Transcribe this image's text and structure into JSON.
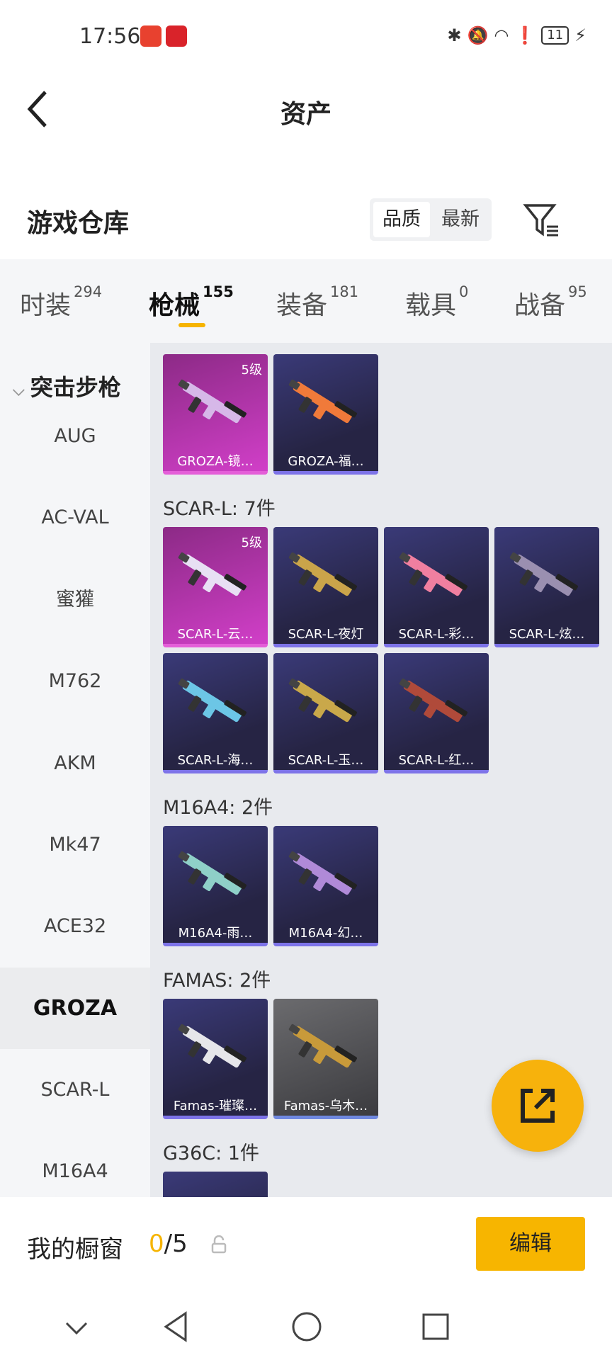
{
  "status_bar": {
    "time": "17:56",
    "battery": "11"
  },
  "header": {
    "title": "资产"
  },
  "warehouse": {
    "title": "游戏仓库",
    "sort": [
      "品质",
      "最新"
    ]
  },
  "tabs": [
    {
      "label": "时装",
      "count": "294"
    },
    {
      "label": "枪械",
      "count": "155"
    },
    {
      "label": "装备",
      "count": "181"
    },
    {
      "label": "载具",
      "count": "0"
    },
    {
      "label": "战备",
      "count": "95"
    }
  ],
  "sidebar": {
    "category": "突击步枪",
    "items": [
      "AUG",
      "AC-VAL",
      "蜜獾",
      "M762",
      "AKM",
      "Mk47",
      "ACE32",
      "GROZA",
      "SCAR-L",
      "M16A4"
    ],
    "selected": "GROZA"
  },
  "groups": [
    {
      "header": "",
      "items": [
        {
          "name": "GROZA-镜…",
          "level": "5级",
          "style": "pink"
        },
        {
          "name": "GROZA-福…",
          "style": "blue"
        }
      ]
    },
    {
      "header": "SCAR-L: 7件",
      "items": [
        {
          "name": "SCAR-L-云…",
          "level": "5级",
          "style": "pink"
        },
        {
          "name": "SCAR-L-夜灯",
          "style": "blue"
        },
        {
          "name": "SCAR-L-彩…",
          "style": "blue"
        },
        {
          "name": "SCAR-L-炫…",
          "style": "blue"
        },
        {
          "name": "SCAR-L-海…",
          "style": "blue"
        },
        {
          "name": "SCAR-L-玉…",
          "style": "blue"
        },
        {
          "name": "SCAR-L-红…",
          "style": "blue"
        }
      ]
    },
    {
      "header": "M16A4: 2件",
      "items": [
        {
          "name": "M16A4-雨…",
          "style": "blue"
        },
        {
          "name": "M16A4-幻…",
          "style": "blue"
        }
      ]
    },
    {
      "header": "FAMAS: 2件",
      "items": [
        {
          "name": "Famas-璀璨…",
          "style": "blue"
        },
        {
          "name": "Famas-乌木…",
          "style": "gray"
        }
      ]
    },
    {
      "header": "G36C: 1件",
      "items": [
        {
          "name": "",
          "style": "blue"
        }
      ]
    }
  ],
  "showcase": {
    "label": "我的橱窗",
    "current": "0",
    "total": "/5",
    "edit": "编辑"
  },
  "colors": {
    "accent": "#f7b500",
    "rare_pink": "#d13fc8",
    "card_blue": "#2c2a52"
  }
}
